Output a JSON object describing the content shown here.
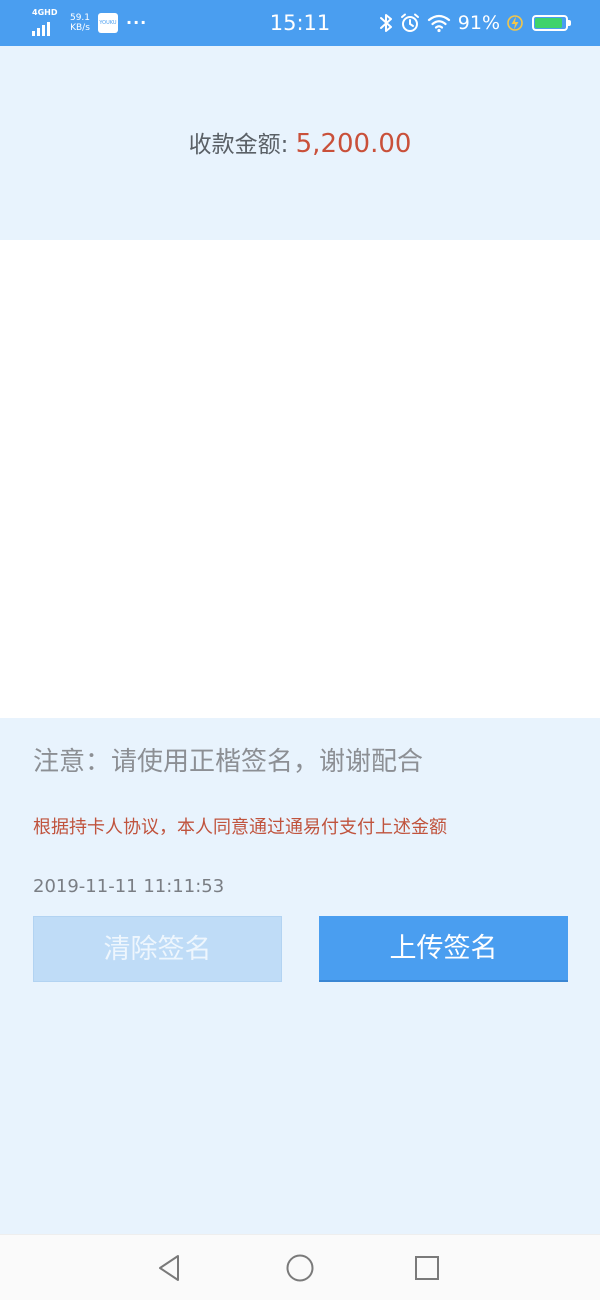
{
  "status_bar": {
    "network_type": "4GHD",
    "net_speed_value": "59.1",
    "net_speed_unit": "KB/s",
    "app_icon_text": "YOUKU",
    "more": "···",
    "time": "15:11",
    "battery_percent": "91%",
    "battery_level": 0.91,
    "icons": [
      "bluetooth-icon",
      "alarm-icon",
      "wifi-icon",
      "battery-saver-icon",
      "battery-icon"
    ]
  },
  "payment": {
    "amount_label": "收款金额: ",
    "amount_value": "5,200.00"
  },
  "notice_text": "注意：请使用正楷签名，谢谢配合",
  "agreement_text": "根据持卡人协议，本人同意通过通易付支付上述金额",
  "datetime": "2019-11-11 11:11:53",
  "buttons": {
    "clear_label": "清除签名",
    "upload_label": "上传签名"
  },
  "navigation": [
    "back-icon",
    "home-icon",
    "recent-apps-icon"
  ],
  "colors": {
    "status_bar": "#4a9ef0",
    "panel_background": "#e8f3fd",
    "amount": "#c9503a",
    "agreement": "#c0533d",
    "primary_button": "#4a9ef0",
    "disabled_button": "#bfdcf7",
    "battery": "#3fd36b"
  }
}
